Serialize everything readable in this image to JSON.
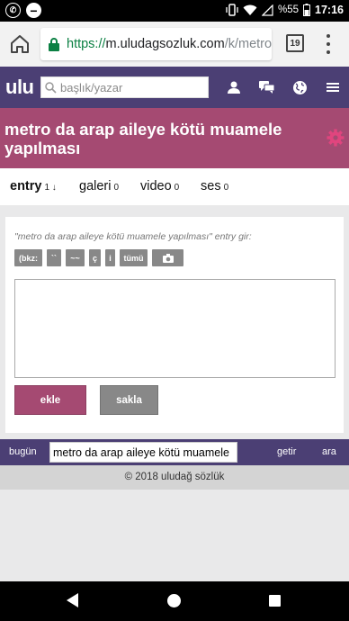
{
  "status_bar": {
    "battery": "%55",
    "time": "17:16"
  },
  "browser": {
    "url_proto": "https://",
    "url_host": "m.uludagsozluk.com",
    "url_path": "/k/metro-d",
    "tab_count": "19"
  },
  "header": {
    "logo": "ulu",
    "search_placeholder": "başlık/yazar",
    "icons": [
      "user-icon",
      "messages-icon",
      "globe-icon",
      "menu-icon"
    ]
  },
  "topic": {
    "title": "metro da arap aileye kötü muamele yapılması"
  },
  "tabs": [
    {
      "label": "entry",
      "count": "1 ↓",
      "active": true
    },
    {
      "label": "galeri",
      "count": "0",
      "active": false
    },
    {
      "label": "video",
      "count": "0",
      "active": false
    },
    {
      "label": "ses",
      "count": "0",
      "active": false
    }
  ],
  "editor": {
    "prompt": "\"metro da arap aileye kötü muamele yapılması\" entry gir:",
    "toolbar": [
      "(bkz:",
      "``",
      "~~",
      "ç",
      "i",
      "tümü"
    ],
    "submit_label": "ekle",
    "save_label": "sakla"
  },
  "bottom_nav": {
    "today": "bugün",
    "input_value": "metro da arap aileye kötü muamele",
    "go": "getir",
    "search": "ara"
  },
  "footer": {
    "copyright": "© 2018 uludağ sözlük"
  },
  "colors": {
    "header": "#4b3f74",
    "accent": "#a54a72",
    "button_gray": "#888888"
  }
}
